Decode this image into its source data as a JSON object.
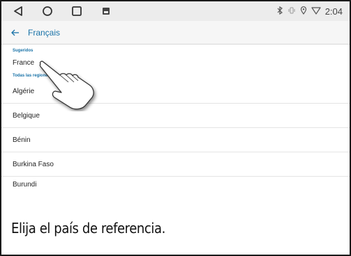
{
  "status_bar": {
    "clock": "2:04",
    "icons": [
      "bluetooth-icon",
      "vibrate-icon",
      "location-icon",
      "wifi-icon"
    ]
  },
  "nav_bar": {
    "buttons": [
      "back-triangle-icon",
      "home-circle-icon",
      "recents-square-icon",
      "screenshot-icon"
    ]
  },
  "header": {
    "back_icon": "arrow-left-icon",
    "title": "Français"
  },
  "list": {
    "suggested_label": "Sugeridos",
    "suggested": [
      "France"
    ],
    "all_label": "Todas las regiones",
    "regions": [
      "Algérie",
      "Belgique",
      "Bénin",
      "Burkina Faso",
      "Burundi"
    ]
  },
  "caption": "Elija el país de referencia.",
  "colors": {
    "accent": "#1a73a8",
    "status_bg": "#ececec",
    "divider": "#e4e4e4"
  }
}
